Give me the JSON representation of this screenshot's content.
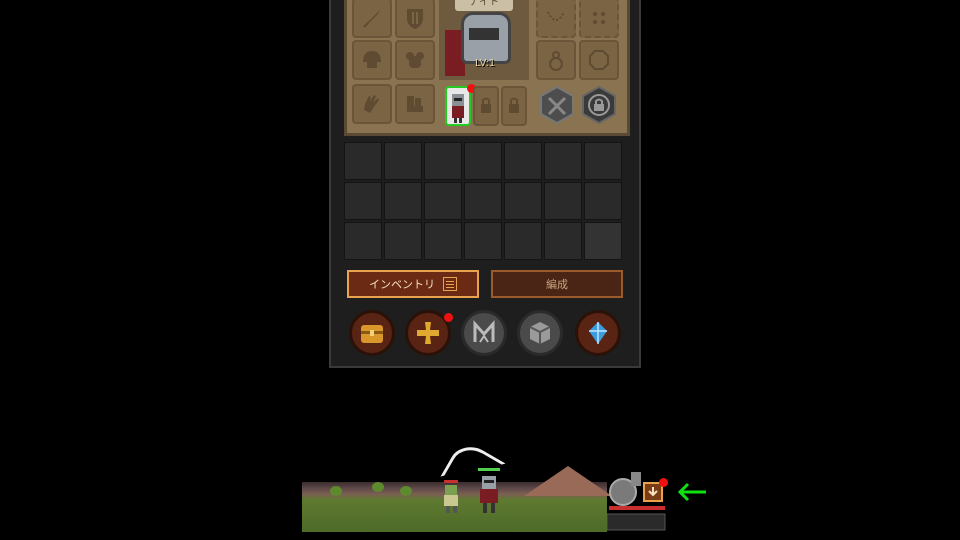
{
  "equipment": {
    "job_label": "ナイト",
    "level_label": "LV:1"
  },
  "tabs": {
    "inventory_label": "インベントリ",
    "formation_label": "編成"
  },
  "icons": {
    "weapon": "sword-icon",
    "shield": "shield-icon",
    "helmet": "helmet-icon",
    "armor": "armor-icon",
    "gloves": "glove-icon",
    "boots": "boot-icon",
    "chest_button": "chest-icon",
    "cross_button": "cross-icon",
    "rune_button": "rune-icon",
    "cube_button": "cube-icon",
    "gem_button": "gem-icon"
  },
  "colors": {
    "accent_orange": "#e9a24e",
    "notification_red": "#e11111",
    "selected_green": "#22cc22",
    "arrow_green": "#10e010"
  },
  "inventory": {
    "rows": 3,
    "columns": 7
  }
}
